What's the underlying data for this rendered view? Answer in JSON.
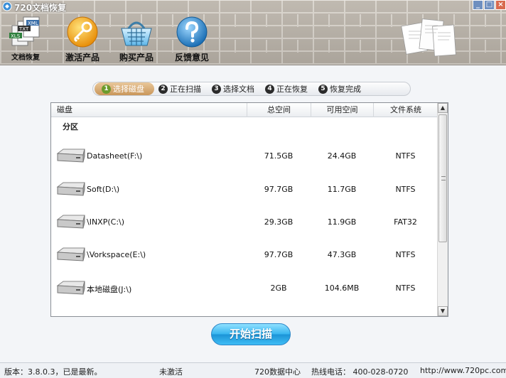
{
  "window": {
    "title": "720文档恢复",
    "minimize_label": "_",
    "maximize_label": "□",
    "close_label": "×"
  },
  "toolbar": {
    "items": [
      {
        "label": "文档恢复",
        "icon": "documents-icon"
      },
      {
        "label": "激活产品",
        "icon": "key-icon"
      },
      {
        "label": "购买产品",
        "icon": "shopping-basket-icon"
      },
      {
        "label": "反馈意见",
        "icon": "help-icon"
      }
    ],
    "doc_labels": [
      "TXT",
      "XML",
      "XLS"
    ]
  },
  "steps": [
    {
      "num": "1",
      "label": "选择磁盘",
      "active": true
    },
    {
      "num": "2",
      "label": "正在扫描",
      "active": false
    },
    {
      "num": "3",
      "label": "选择文档",
      "active": false
    },
    {
      "num": "4",
      "label": "正在恢复",
      "active": false
    },
    {
      "num": "5",
      "label": "恢复完成",
      "active": false
    }
  ],
  "disk_list": {
    "columns": [
      "磁盘",
      "总空间",
      "可用空间",
      "文件系统"
    ],
    "group_label": "分区",
    "rows": [
      {
        "name": "Datasheet(F:\\)",
        "total": "71.5GB",
        "free": "24.4GB",
        "fs": "NTFS"
      },
      {
        "name": "Soft(D:\\)",
        "total": "97.7GB",
        "free": "11.7GB",
        "fs": "NTFS"
      },
      {
        "name": "\\INXP(C:\\)",
        "total": "29.3GB",
        "free": "11.9GB",
        "fs": "FAT32"
      },
      {
        "name": "\\Vorkspace(E:\\)",
        "total": "97.7GB",
        "free": "47.3GB",
        "fs": "NTFS"
      },
      {
        "name": "本地磁盘(J:\\)",
        "total": "2GB",
        "free": "104.6MB",
        "fs": "NTFS"
      }
    ],
    "scroll_up": "▲",
    "scroll_down": "▼"
  },
  "scan_button": "开始扫描",
  "status": {
    "version": "版本：3.8.0.3，已是最新。",
    "activation": "未激活",
    "center": "720数据中心",
    "hotline": "热线电话：  400-028-0720",
    "website": "http://www.720pc.com"
  },
  "colors": {
    "accent": "#35b4ef",
    "step_active": "#c9965a",
    "link": "#1d58b8"
  }
}
